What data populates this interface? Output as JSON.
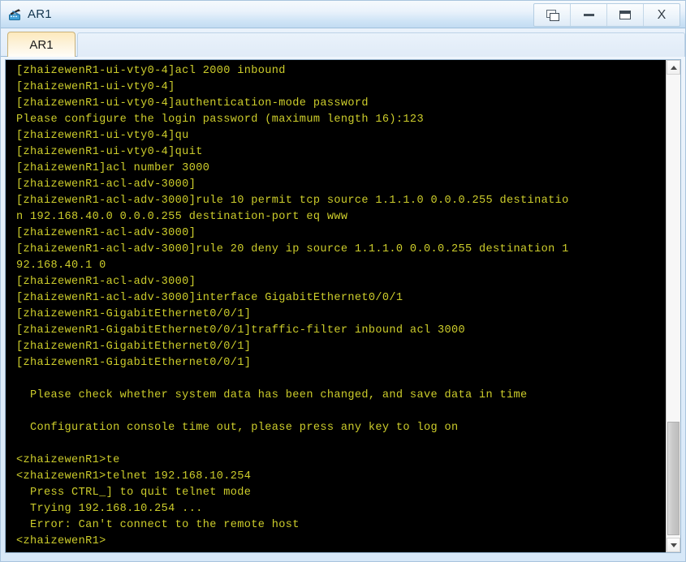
{
  "window": {
    "title": "AR1",
    "icon": "router-icon",
    "controls": [
      {
        "name": "restore-button",
        "icon": "restore-icon",
        "label": ""
      },
      {
        "name": "minimize-button",
        "icon": "minimize-icon",
        "label": ""
      },
      {
        "name": "maximize-button",
        "icon": "maximize-icon",
        "label": ""
      },
      {
        "name": "close-button",
        "icon": "close-icon",
        "label": "X"
      }
    ]
  },
  "tabs": [
    {
      "label": "AR1",
      "active": true
    }
  ],
  "terminal": {
    "background_color": "#000000",
    "text_color": "#cdcd2b",
    "lines": [
      "[zhaizewenR1-ui-vty0-4]acl 2000 inbound",
      "[zhaizewenR1-ui-vty0-4]",
      "[zhaizewenR1-ui-vty0-4]authentication-mode password",
      "Please configure the login password (maximum length 16):123",
      "[zhaizewenR1-ui-vty0-4]qu",
      "[zhaizewenR1-ui-vty0-4]quit",
      "[zhaizewenR1]acl number 3000",
      "[zhaizewenR1-acl-adv-3000]",
      "[zhaizewenR1-acl-adv-3000]rule 10 permit tcp source 1.1.1.0 0.0.0.255 destinatio",
      "n 192.168.40.0 0.0.0.255 destination-port eq www",
      "[zhaizewenR1-acl-adv-3000]",
      "[zhaizewenR1-acl-adv-3000]rule 20 deny ip source 1.1.1.0 0.0.0.255 destination 1",
      "92.168.40.1 0",
      "[zhaizewenR1-acl-adv-3000]",
      "[zhaizewenR1-acl-adv-3000]interface GigabitEthernet0/0/1",
      "[zhaizewenR1-GigabitEthernet0/0/1]",
      "[zhaizewenR1-GigabitEthernet0/0/1]traffic-filter inbound acl 3000",
      "[zhaizewenR1-GigabitEthernet0/0/1]",
      "[zhaizewenR1-GigabitEthernet0/0/1]",
      "",
      "  Please check whether system data has been changed, and save data in time",
      "",
      "  Configuration console time out, please press any key to log on",
      "",
      "<zhaizewenR1>te",
      "<zhaizewenR1>telnet 192.168.10.254",
      "  Press CTRL_] to quit telnet mode",
      "  Trying 192.168.10.254 ...",
      "  Error: Can't connect to the remote host",
      "<zhaizewenR1>"
    ]
  },
  "scrollbar": {
    "up_icon": "chevron-up-icon",
    "down_icon": "chevron-down-icon"
  }
}
